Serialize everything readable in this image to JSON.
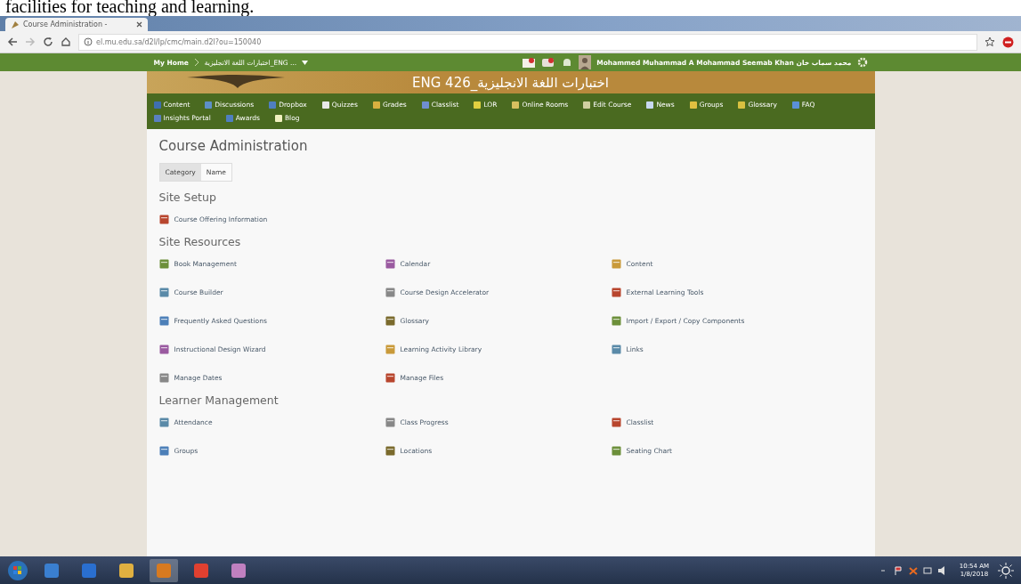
{
  "document_text": "facilities for teaching and learning.",
  "browser": {
    "tab_title": "Course Administration - ",
    "address": "el.mu.edu.sa/d2l/lp/cmc/main.d2l?ou=150040"
  },
  "minibar": {
    "home": "My Home",
    "course": "اختبارات اللغة الانجليزية_ENG ...",
    "user": "Mohammed Muhammad A Mohammad Seemab Khan محمد سماب خان"
  },
  "banner": {
    "title": "ENG 426_اختبارات اللغة الانجليزية"
  },
  "nav": [
    {
      "label": "Content"
    },
    {
      "label": "Discussions"
    },
    {
      "label": "Dropbox"
    },
    {
      "label": "Quizzes"
    },
    {
      "label": "Grades"
    },
    {
      "label": "Classlist"
    },
    {
      "label": "LOR"
    },
    {
      "label": "Online Rooms"
    },
    {
      "label": "Edit Course"
    },
    {
      "label": "News"
    },
    {
      "label": "Groups"
    },
    {
      "label": "Glossary"
    },
    {
      "label": "FAQ"
    },
    {
      "label": "Insights Portal"
    },
    {
      "label": "Awards"
    },
    {
      "label": "Blog"
    }
  ],
  "page": {
    "title": "Course Administration",
    "sort_tabs": [
      {
        "label": "Category",
        "selected": true
      },
      {
        "label": "Name",
        "selected": false
      }
    ],
    "sections": [
      {
        "title": "Site Setup",
        "items": [
          {
            "label": "Course Offering Information"
          }
        ]
      },
      {
        "title": "Site Resources",
        "items": [
          {
            "label": "Book Management"
          },
          {
            "label": "Calendar"
          },
          {
            "label": "Content"
          },
          {
            "label": "Course Builder"
          },
          {
            "label": "Course Design Accelerator"
          },
          {
            "label": "External Learning Tools"
          },
          {
            "label": "Frequently Asked Questions"
          },
          {
            "label": "Glossary"
          },
          {
            "label": "Import / Export / Copy Components"
          },
          {
            "label": "Instructional Design Wizard"
          },
          {
            "label": "Learning Activity Library"
          },
          {
            "label": "Links"
          },
          {
            "label": "Manage Dates"
          },
          {
            "label": "Manage Files"
          }
        ]
      },
      {
        "title": "Learner Management",
        "items": [
          {
            "label": "Attendance"
          },
          {
            "label": "Class Progress"
          },
          {
            "label": "Classlist"
          },
          {
            "label": "Groups"
          },
          {
            "label": "Locations"
          },
          {
            "label": "Seating Chart"
          }
        ]
      }
    ]
  },
  "taskbar": {
    "time": "10:54 AM",
    "date": "1/8/2018"
  }
}
